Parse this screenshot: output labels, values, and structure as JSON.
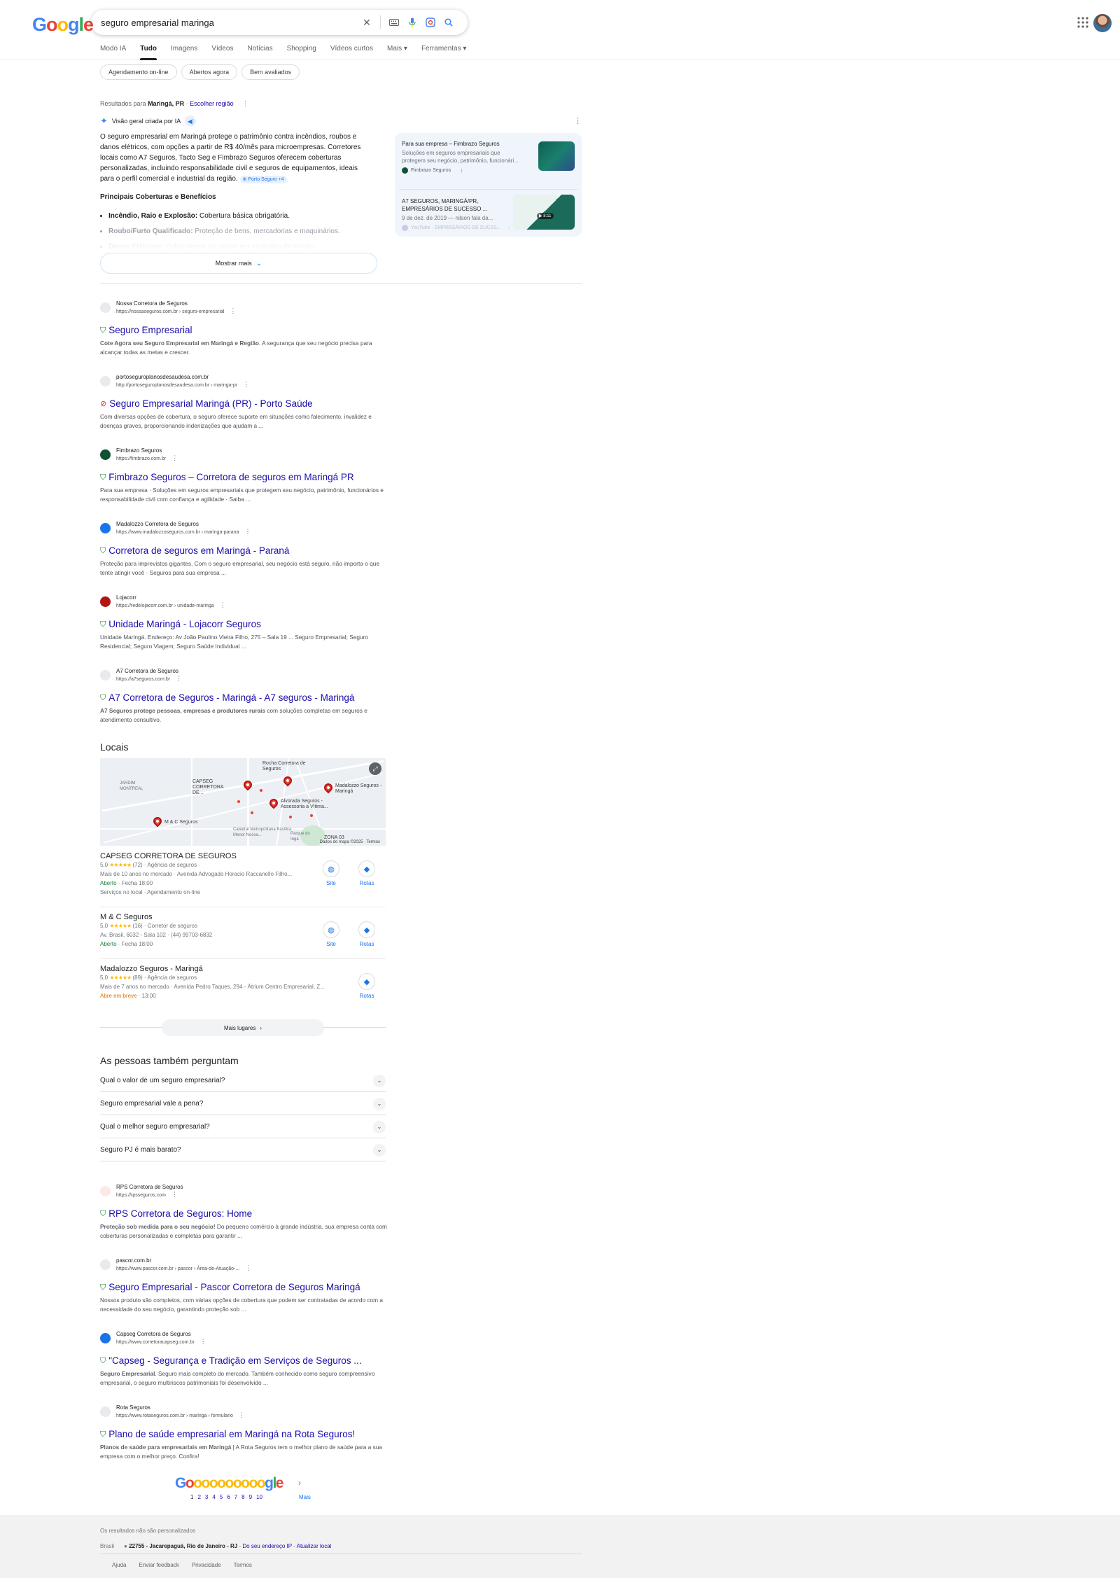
{
  "search": {
    "query": "seguro empresarial maringa"
  },
  "tabs": [
    {
      "label": "Modo IA"
    },
    {
      "label": "Tudo"
    },
    {
      "label": "Imagens"
    },
    {
      "label": "Vídeos"
    },
    {
      "label": "Notícias"
    },
    {
      "label": "Shopping"
    },
    {
      "label": "Vídeos curtos"
    },
    {
      "label": "Mais"
    },
    {
      "label": "Ferramentas"
    }
  ],
  "chips": [
    {
      "label": "Agendamento on-line"
    },
    {
      "label": "Abertos agora"
    },
    {
      "label": "Bem avaliados"
    }
  ],
  "region": {
    "prefix": "Resultados para",
    "place": "Maringá, PR",
    "link": "Escolher região"
  },
  "ai_overview": {
    "label": "Visão geral criada por IA",
    "text": "O seguro empresarial em Maringá protege o patrimônio contra incêndios, roubos e danos elétricos, com opções a partir de R$ 40/mês para microempresas. Corretores locais como A7 Seguros, Tacto Seg e Fimbrazo Seguros oferecem coberturas personalizadas, incluindo responsabilidade civil e seguros de equipamentos, ideais para o perfil comercial e industrial da região.",
    "cite": "Porto Seguro +4",
    "subhead": "Principais Coberturas e Benefícios",
    "bullets": [
      {
        "bold": "Incêndio, Raio e Explosão:",
        "text": " Cobertura básica obrigatória."
      },
      {
        "bold": "Roubo/Furto Qualificado:",
        "text": " Proteção de bens, mercadorias e maquinários."
      },
      {
        "bold": "Danos Elétricos:",
        "text": " Cobre danos causados por variações de tensão."
      }
    ],
    "show_more": "Mostrar mais",
    "cards": [
      {
        "title": "Para sua empresa – Fimbrazo Seguros",
        "desc": "Soluções em seguros empresariais que protegem seu negócio, patrimônio, funcionári...",
        "source": "Fimbrazo Seguros"
      },
      {
        "title": "A7 SEGUROS, MARINGÁ/PR, EMPRESÁRIOS DE SUCESSO ...",
        "desc": "9 de dez. de 2019 — nilson fala da...",
        "source": "YouTube · EMPRESÁRIOS DE SUCES...",
        "duration": "8:11"
      }
    ]
  },
  "results_top": [
    {
      "site": "Nossa Corretora de Seguros",
      "url": "https://nossaseguros.com.br › seguro-empresarial",
      "title": "Seguro Empresarial",
      "snippet_bold": "Cote Agora seu Seguro Empresarial em Maringá e Região",
      "snippet": ". A segurança que seu negócio precisa para alcançar todas as metas e crescer.",
      "fav": "#e8eaed"
    },
    {
      "site": "portoseguroplanosdesaudesa.com.br",
      "url": "http://portoseguroplanosdesaudesa.com.br › maringa-pr",
      "title": "Seguro Empresarial Maringá (PR) - Porto Saúde",
      "snippet_bold": "",
      "snippet": "Com diversas opções de cobertura, o seguro oferece suporte em situações como falecimento, invalidez e doenças graves, proporcionando indenizações que ajudam a ...",
      "fav": "#e8eaed"
    },
    {
      "site": "Fimbrazo Seguros",
      "url": "https://fimbrazo.com.br",
      "title": "Fimbrazo Seguros – Corretora de seguros em Maringá PR",
      "snippet_bold": "",
      "snippet": "Para sua empresa · Soluções em seguros empresariais que protegem seu negócio, patrimônio, funcionários e responsabilidade civil com confiança e agilidade · Saiba ...",
      "fav": "#0f5132"
    },
    {
      "site": "Madalozzo Corretora de Seguros",
      "url": "https://www.madalozzoseguros.com.br › maringa-parana",
      "title": "Corretora de seguros em Maringá - Paraná",
      "snippet_bold": "",
      "snippet": "Proteção para imprevistos gigantes. Com o seguro empresarial, seu negócio está seguro, não importa o que tente atingir você · Seguros para sua empresa ...",
      "fav": "#1a73e8"
    },
    {
      "site": "Lojacorr",
      "url": "https://redelojacorr.com.br › unidade-maringa",
      "title": "Unidade Maringá - Lojacorr Seguros",
      "snippet_bold": "",
      "snippet": "Unidade Maringá. Endereço: Av João Paulino Vieira Filho, 275 – Sala 19 ... Seguro Empresarial; Seguro Residencial; Seguro Viagem; Seguro Saúde Individual ...",
      "fav": "#b31412"
    },
    {
      "site": "A7 Corretora de Seguros",
      "url": "https://a7seguros.com.br",
      "title": "A7 Corretora de Seguros - Maringá - A7 seguros - Maringá",
      "snippet_bold": "A7 Seguros protege pessoas, empresas e produtores rurais",
      "snippet": " com soluções completas em seguros e atendimento consultivo.",
      "fav": "#e8eaed"
    }
  ],
  "locais": {
    "title": "Locais",
    "map_labels": {
      "rocha": "Rocha Corretora de Seguros",
      "capseg": "CAPSEG CORRETORA DE...",
      "madalozzo": "Madalozzo Seguros - Maringá",
      "alvorada": "Alvorada Seguros - Assessoria a Vítima...",
      "mc": "M & C Seguros",
      "jardim": "JARDIM MONTREAL",
      "catedral": "Catedral Metropolitana Basílica Menor Nossa...",
      "parque": "Parque do Ingá",
      "zona": "ZONA 03",
      "credit": "Dados do mapa ©2025",
      "terms": "Termos"
    },
    "places": [
      {
        "name": "CAPSEG CORRETORA DE SEGUROS",
        "rating": "5,0",
        "stars": "★★★★★",
        "reviews": "(72)",
        "type": "Agência de seguros",
        "line2": "Mais de 10 anos no mercado · Avenida Advogado Horacio Raccanello Filho...",
        "status": "Aberto",
        "hours": " · Fecha 18:00",
        "line4": "Serviços no local · Agendamento on-line"
      },
      {
        "name": "M & C Seguros",
        "rating": "5,0",
        "stars": "★★★★★",
        "reviews": "(16)",
        "type": "Corretor de seguros",
        "line2": "Av. Brasil, 6032 - Sala 102 · (44) 99703-6832",
        "status": "Aberto",
        "hours": " · Fecha 18:00",
        "line4": ""
      },
      {
        "name": "Madalozzo Seguros - Maringá",
        "rating": "5,0",
        "stars": "★★★★★",
        "reviews": "(89)",
        "type": "Agência de seguros",
        "line2": "Mais de 7 anos no mercado · Avenida Pedro Taques, 294 - Átrium Centro Empresarial, Z...",
        "status": "Abre em breve",
        "hours": " · 13:00",
        "line4": ""
      }
    ],
    "site_label": "Site",
    "route_label": "Rotas",
    "more": "Mais lugares"
  },
  "paa": {
    "title": "As pessoas também perguntam",
    "questions": [
      "Qual o valor de um seguro empresarial?",
      "Seguro empresarial vale a pena?",
      "Qual o melhor seguro empresarial?",
      "Seguro PJ é mais barato?"
    ]
  },
  "results_bottom": [
    {
      "site": "RPS Corretora de Seguros",
      "url": "https://rpsseguros.com",
      "title": "RPS Corretora de Seguros: Home",
      "snippet_bold": "Proteção sob medida para o seu negócio!",
      "snippet": " Do pequeno comércio à grande indústria, sua empresa conta com coberturas personalizadas e completas para garantir ...",
      "fav": "#fce8e6"
    },
    {
      "site": "pascor.com.br",
      "url": "https://www.pascor.com.br › pascor › Área-de-Atuação-...",
      "title": "Seguro Empresarial - Pascor Corretora de Seguros Maringá",
      "snippet_bold": "",
      "snippet": "Nossos produto são completos, com várias opções de cobertura que podem ser contratadas de acordo com a necessidade do seu negócio, garantindo proteção sob ...",
      "fav": "#e8eaed"
    },
    {
      "site": "Capseg Corretora de Seguros",
      "url": "https://www.corretoracapseg.com.br",
      "title": "\"Capseg - Segurança e Tradição em Serviços de Seguros ...",
      "snippet_bold": "Seguro Empresarial",
      "snippet": ". Seguro mais completo do mercado. Também conhecido como seguro compreensivo empresarial, o seguro multiriscos patrimoniais foi desenvolvido ...",
      "fav": "#1a73e8"
    },
    {
      "site": "Rota Seguros",
      "url": "https://www.rotaseguros.com.br › maringa › formulario",
      "title": "Plano de saúde empresarial em Maringá na Rota Seguros!",
      "snippet_bold": "Planos de saúde para empresariais em Maringá",
      "snippet": " | A Rota Seguros tem o melhor plano de saúde para a sua empresa com o melhor preço. Confira!",
      "fav": "#e8eaed"
    }
  ],
  "pager": {
    "pages": [
      "1",
      "2",
      "3",
      "4",
      "5",
      "6",
      "7",
      "8",
      "9",
      "10"
    ],
    "more": "Mais"
  },
  "footer": {
    "notice": "Os resultados não são personalizados",
    "country": "Brasil",
    "location": "22755 - Jacarepaguá, Rio de Janeiro - RJ",
    "from_ip": "Do seu endereço IP",
    "update": "Atualizar local",
    "links": [
      "Ajuda",
      "Enviar feedback",
      "Privacidade",
      "Termos"
    ]
  }
}
